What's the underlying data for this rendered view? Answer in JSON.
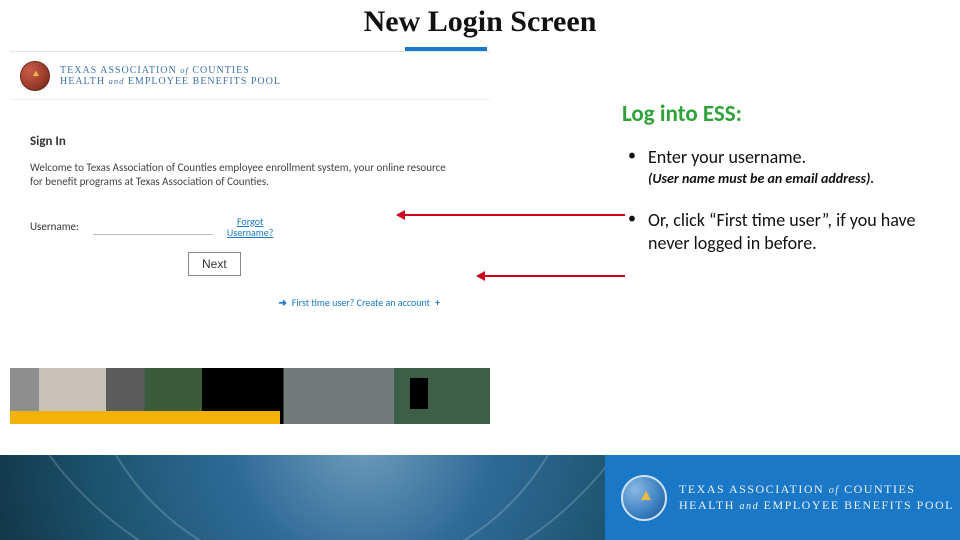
{
  "slide": {
    "title": "New Login Screen"
  },
  "screenshot": {
    "brand_line1_a": "TEXAS ASSOCIATION ",
    "brand_line1_of": "of",
    "brand_line1_b": " COUNTIES",
    "brand_line2_a": "HEALTH ",
    "brand_line2_and": "and",
    "brand_line2_b": " EMPLOYEE BENEFITS POOL",
    "signin": "Sign In",
    "welcome": "Welcome to Texas Association of Counties employee enrollment system, your online resource for benefit programs at Texas Association of Counties.",
    "username_label": "Username:",
    "forgot_line1": "Forgot",
    "forgot_line2": "Username?",
    "next_button": "Next",
    "first_time": "First time user? Create an account"
  },
  "instructions": {
    "heading": "Log into ESS:",
    "bullet1": "Enter your username.",
    "bullet1_note": "(User name must be an email address).",
    "bullet2": "Or, click “First time user”, if you have never logged in before."
  },
  "footer": {
    "brand_line1_a": "TEXAS ASSOCIATION ",
    "brand_line1_of": "of",
    "brand_line1_b": " COUNTIES",
    "brand_line2_a": "HEALTH ",
    "brand_line2_and": "and",
    "brand_line2_b": " EMPLOYEE BENEFITS POOL"
  }
}
